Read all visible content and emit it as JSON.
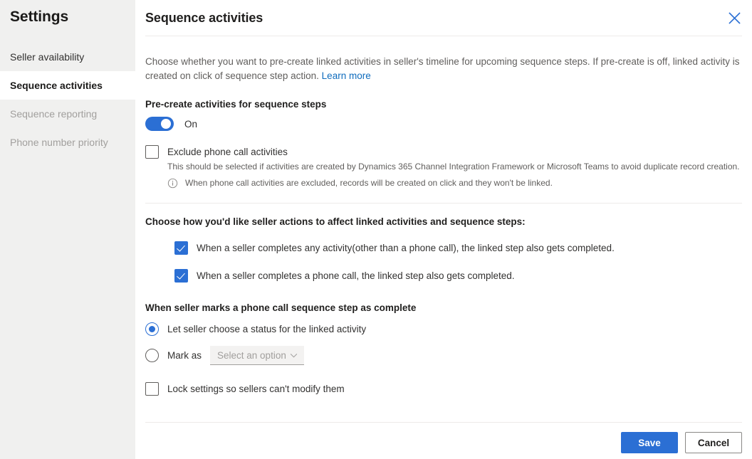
{
  "sidebar": {
    "title": "Settings",
    "items": [
      {
        "label": "Seller availability",
        "state": "normal"
      },
      {
        "label": "Sequence activities",
        "state": "active"
      },
      {
        "label": "Sequence reporting",
        "state": "disabled"
      },
      {
        "label": "Phone number priority",
        "state": "disabled"
      }
    ]
  },
  "panel": {
    "title": "Sequence activities",
    "close_icon": "close-icon",
    "description_part1": "Choose whether you want to pre-create linked activities in seller's timeline for upcoming sequence steps. If pre-create is off, linked activity is created on click of sequence step action.",
    "learn_more": "Learn more"
  },
  "precreate": {
    "label": "Pre-create activities for sequence steps",
    "toggle_state": "on",
    "toggle_label": "On",
    "exclude": {
      "label": "Exclude phone call activities",
      "checked": false,
      "fineprint": "This should be selected if activities are created by Dynamics 365 Channel Integration Framework or Microsoft Teams to avoid duplicate record creation.",
      "info_icon": "info-icon",
      "info_text": "When phone call activities are excluded, records will be created on click and they won't be linked."
    }
  },
  "seller_actions": {
    "heading": "Choose how you'd like seller actions to affect linked activities and sequence steps:",
    "options": [
      {
        "label": "When a seller completes any activity(other than a phone call), the linked step also gets completed.",
        "checked": true
      },
      {
        "label": "When a seller completes a phone call, the linked step also gets completed.",
        "checked": true
      }
    ]
  },
  "phone_call_complete": {
    "heading": "When seller marks a phone call sequence step as complete",
    "radio_let_seller": {
      "label": "Let seller choose a status for the linked activity",
      "selected": true
    },
    "radio_mark_as": {
      "label": "Mark as",
      "selected": false
    },
    "select": {
      "placeholder": "Select an option",
      "value": "",
      "chevron_icon": "chevron-down-icon"
    }
  },
  "lock": {
    "label": "Lock settings so sellers can't modify them",
    "checked": false
  },
  "footer": {
    "save_label": "Save",
    "cancel_label": "Cancel"
  },
  "colors": {
    "accent": "#2b6fd4",
    "link": "#0f6cbd",
    "sidebar_bg": "#f0f0ef",
    "divider": "#edebe9"
  }
}
